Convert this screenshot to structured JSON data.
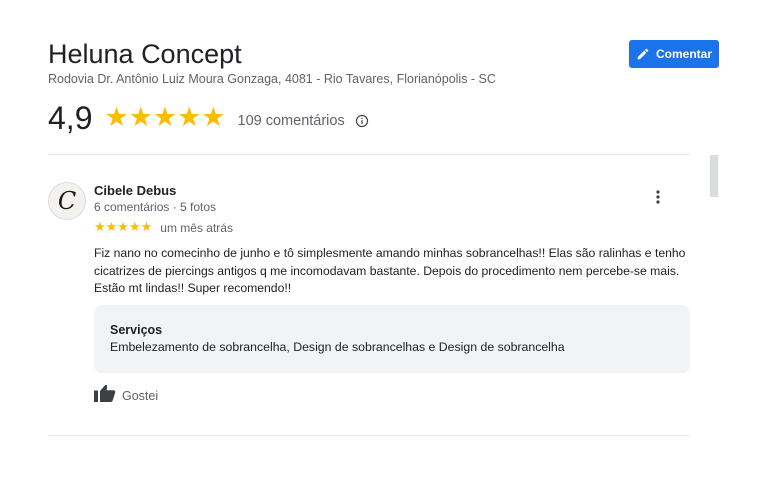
{
  "header": {
    "title": "Heluna Concept",
    "address": "Rodovia Dr. Antônio Luiz Moura Gonzaga, 4081 - Rio Tavares, Florianópolis - SC",
    "comment_button_label": "Comentar",
    "comment_icon": "pencil-icon"
  },
  "summary": {
    "rating": "4,9",
    "stars": "★★★★★",
    "review_count": "109 comentários",
    "info_icon": "info-icon"
  },
  "review": {
    "avatar_letter": "C",
    "author": "Cibele Debus",
    "meta": "6 comentários · 5 fotos",
    "stars": "★★★★★",
    "date": "um mês atrás",
    "text": "Fiz nano no comecinho de junho e tô simplesmente amando minhas sobrancelhas!! Elas são ralinhas e tenho cicatrizes de piercings antigos q me incomodavam bastante.  Depois do procedimento nem percebe-se mais. Estão mt lindas!! Super recomendo!!",
    "services_title": "Serviços",
    "services_list": "Embelezamento de sobrancelha, Design de sobrancelhas e Design de sobrancelha",
    "like_label": "Gostei",
    "like_icon": "thumbs-up-icon",
    "more_icon": "more-vertical-icon"
  },
  "colors": {
    "accent": "#1a73e8",
    "star": "#fbbc04",
    "secondary_text": "#5f6368"
  }
}
